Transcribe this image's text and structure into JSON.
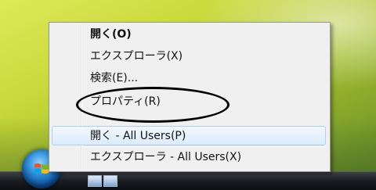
{
  "context_menu": {
    "items": [
      {
        "label": "開く(O)",
        "bold": true
      },
      {
        "label": "エクスプローラ(X)"
      },
      {
        "label": "検索(E)..."
      },
      {
        "label": "プロパティ(R)"
      },
      {
        "label": "開く - All Users(P)"
      },
      {
        "label": "エクスプローラ - All Users(X)"
      }
    ],
    "highlighted_item": "開く - All Users(P)"
  },
  "annotation": {
    "circled_item": "プロパティ(R)"
  },
  "taskbar": {
    "start_button_icon": "windows-flag-icon",
    "quick_launch_icons": [
      "show-desktop-icon",
      "switch-windows-icon"
    ]
  },
  "colors": {
    "menu_background": "#f0f0f0",
    "highlight_border": "#a8d2f5",
    "desktop_accent": "#c9d93a"
  }
}
